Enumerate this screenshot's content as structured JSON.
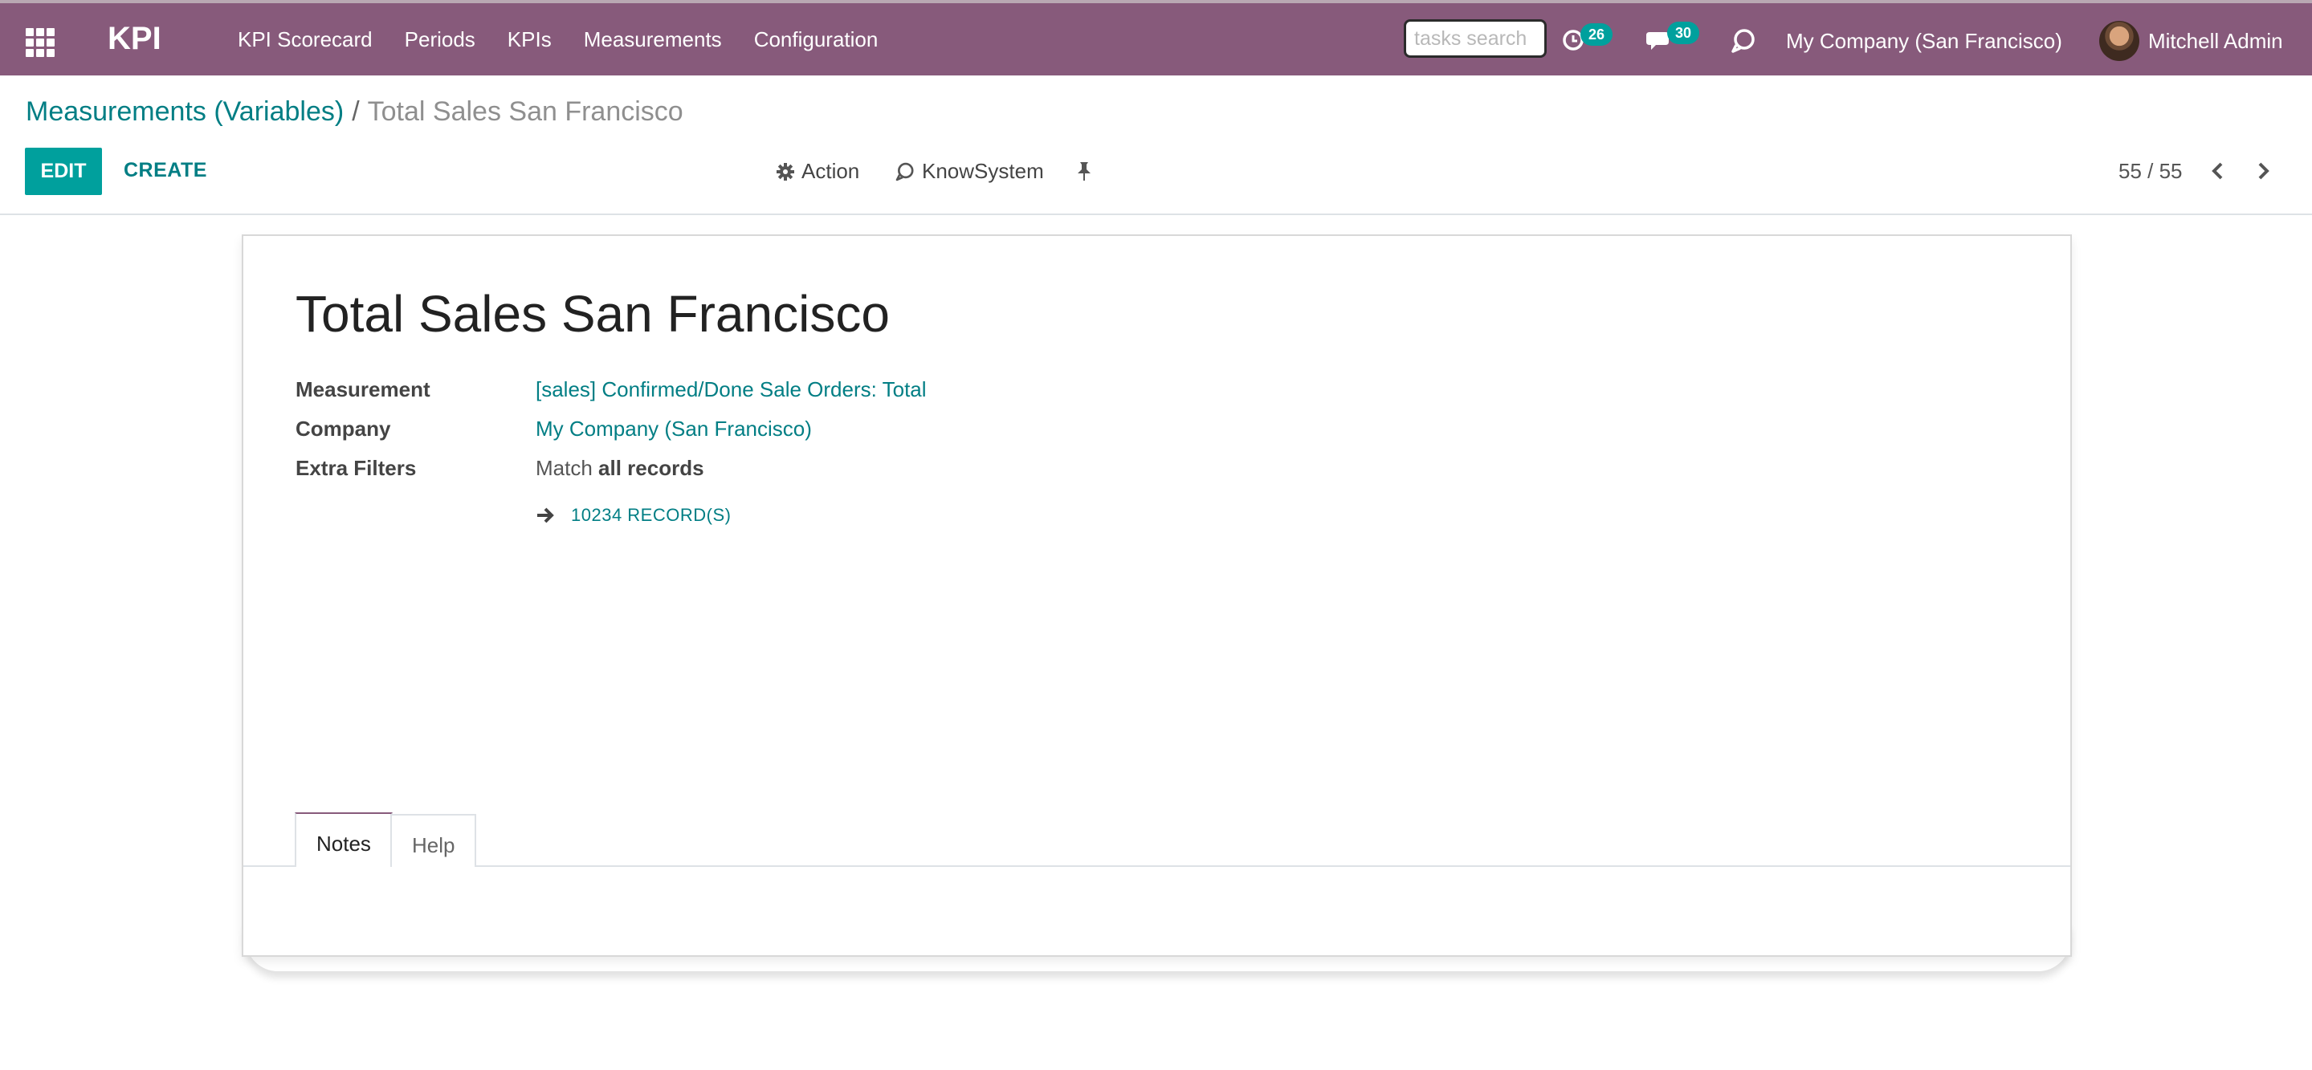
{
  "navbar": {
    "app_name": "KPI",
    "menu": [
      "KPI Scorecard",
      "Periods",
      "KPIs",
      "Measurements",
      "Configuration"
    ],
    "search_placeholder": "tasks search",
    "activity_count": "26",
    "messages_count": "30",
    "company": "My Company (San Francisco)",
    "user": "Mitchell Admin"
  },
  "breadcrumb": {
    "parent": "Measurements (Variables)",
    "separator": "/",
    "current": "Total Sales San Francisco"
  },
  "control_panel": {
    "edit_label": "EDIT",
    "create_label": "CREATE",
    "action_label": "Action",
    "knowsystem_label": "KnowSystem",
    "pager": "55 / 55"
  },
  "record": {
    "title": "Total Sales San Francisco",
    "fields": {
      "measurement_label": "Measurement",
      "measurement_value": "[sales] Confirmed/Done Sale Orders: Total",
      "company_label": "Company",
      "company_value": "My Company (San Francisco)",
      "extra_filters_label": "Extra Filters",
      "extra_filters_prefix": "Match",
      "extra_filters_strong": "all records"
    },
    "records_link": "10234 RECORD(S)"
  },
  "tabs": [
    "Notes",
    "Help"
  ],
  "colors": {
    "navbar": "#875a7b",
    "primary": "#00a09d",
    "link": "#017e84"
  },
  "icons": [
    "apps-grid-icon",
    "clock-icon",
    "chat-icon",
    "knowsystem-icon",
    "gear-icon",
    "pin-icon",
    "arrow-right-icon",
    "chevron-left-icon",
    "chevron-right-icon"
  ]
}
